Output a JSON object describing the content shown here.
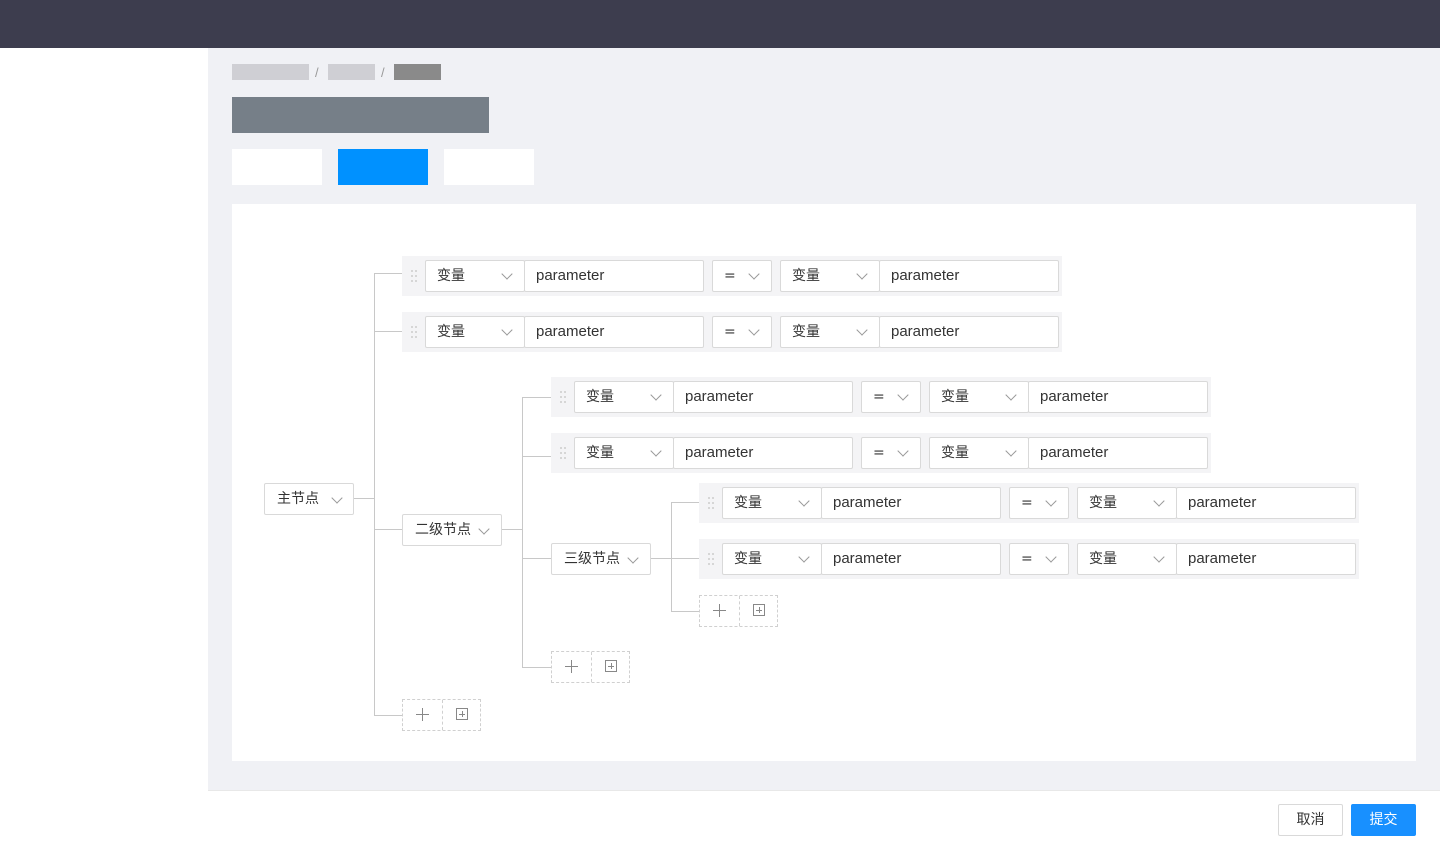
{
  "footer": {
    "cancel_label": "取消",
    "submit_label": "提交"
  },
  "tree": {
    "root_label": "主节点",
    "level2_label": "二级节点",
    "level3_label": "三级节点"
  },
  "condition": {
    "left_type": "变量",
    "left_value": "parameter",
    "operator": "=",
    "right_type": "变量",
    "right_value": "parameter"
  },
  "colors": {
    "topbar": "#3d3d4e",
    "accent": "#1890ff",
    "active_tab": "#0091ff"
  },
  "icons": [
    "drag-handle-icon",
    "chevron-down-icon",
    "plus-icon",
    "add-group-icon"
  ]
}
